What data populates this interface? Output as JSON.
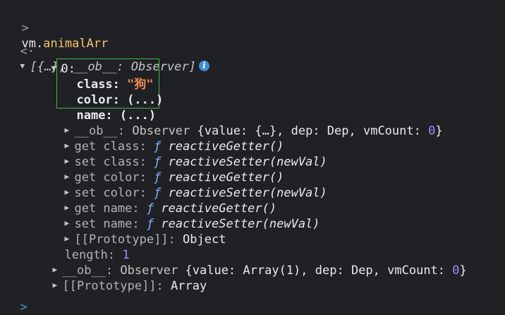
{
  "console": {
    "prompt_symbol": ">",
    "input_expression_base": "vm.",
    "input_expression_prop": "animalArr",
    "result_symbol": "<·",
    "result_summary": "[{…}, __ob__: Observer]",
    "info_icon_glyph": "i",
    "index_key": "0:",
    "highlighted_props": [
      {
        "key": "class",
        "value": "\"狗\""
      },
      {
        "key": "color",
        "value": "(...)"
      },
      {
        "key": "name",
        "value": "(...)"
      }
    ],
    "item_ob": {
      "key": "__ob__",
      "type": "Observer",
      "pre": " {value: ",
      "value": "{…}",
      "mid": ", dep: ",
      "dep": "Dep",
      "mid2": ", vmCount: ",
      "vmcount": "0",
      "post": "}"
    },
    "accessors": [
      {
        "kind": "get class:",
        "fn": "reactiveGetter()"
      },
      {
        "kind": "set class:",
        "fn": "reactiveSetter(newVal)"
      },
      {
        "kind": "get color:",
        "fn": "reactiveGetter()"
      },
      {
        "kind": "set color:",
        "fn": "reactiveSetter(newVal)"
      },
      {
        "kind": "get name:",
        "fn": "reactiveGetter()"
      },
      {
        "kind": "set name:",
        "fn": "reactiveSetter(newVal)"
      }
    ],
    "fn_glyph": "ƒ",
    "item_prototype": {
      "key": "[[Prototype]]",
      "value": "Object"
    },
    "length": {
      "key": "length:",
      "value": "1"
    },
    "array_ob": {
      "key": "__ob__",
      "type": "Observer",
      "pre": " {value: ",
      "value": "Array(1)",
      "mid": ", dep: ",
      "dep": "Dep",
      "mid2": ", vmCount: ",
      "vmcount": "0",
      "post": "}"
    },
    "array_prototype": {
      "key": "[[Prototype]]",
      "value": "Array"
    },
    "next_prompt_symbol": ">"
  },
  "colors": {
    "background": "#202124",
    "property_access": "#f2c46f",
    "string": "#f28b54",
    "number": "#9f8cff",
    "function_glyph": "#7fb0ff",
    "highlight_border": "#4caf50",
    "info_icon": "#3b8ed8"
  }
}
